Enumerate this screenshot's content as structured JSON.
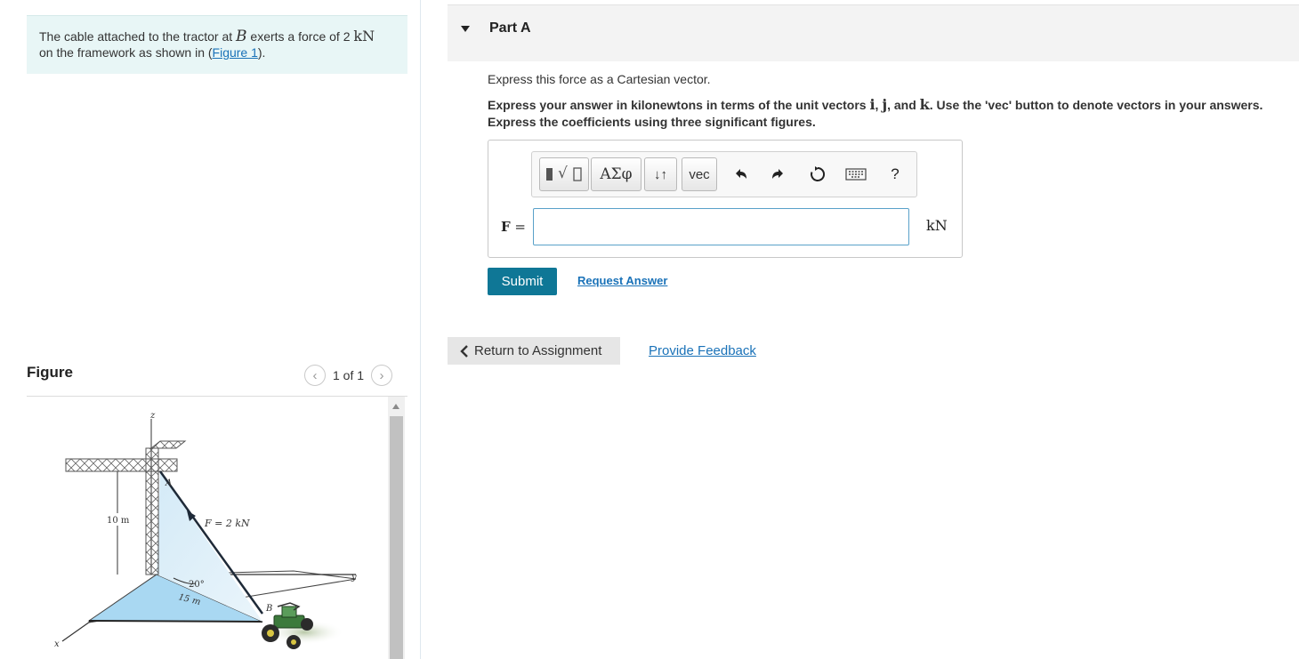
{
  "problem": {
    "text_before": "The cable attached to the tractor at ",
    "point_b": "B",
    "text_middle": " exerts a force of 2 ",
    "unit_kn": "kN",
    "text_line2": " on the framework as shown in (",
    "figure_link": "Figure 1",
    "text_end": ")."
  },
  "figure_panel": {
    "label": "Figure",
    "pager_text": "1 of 1",
    "diagram_labels": {
      "z": "z",
      "a": "A",
      "height": "10 m",
      "force": "F = 2 kN",
      "y": "y",
      "angle": "20°",
      "distance": "15 m",
      "b": "B",
      "x": "x"
    }
  },
  "part": {
    "title": "Part A",
    "instruction": "Express this force as a Cartesian vector.",
    "detail_1": "Express your answer in kilonewtons in terms of the unit vectors ",
    "vec_i": "i",
    "sep_1": ", ",
    "vec_j": "j",
    "sep_2": ", and ",
    "vec_k": "k",
    "detail_2": ". Use the 'vec' button to denote vectors in your answers. Express the coefficients using three significant figures."
  },
  "toolbar": {
    "templates_label": "√",
    "greek_label": "ΑΣφ",
    "arrows_label": "↓↑",
    "vec_label": "vec",
    "help_label": "?"
  },
  "answer": {
    "var_label": "F",
    "equals": " =",
    "value": "",
    "unit": "kN"
  },
  "actions": {
    "submit": "Submit",
    "request": "Request Answer",
    "return": "Return to Assignment",
    "feedback": "Provide Feedback"
  },
  "colors": {
    "problem_bg": "#e8f6f6",
    "submit_bg": "#0f7796",
    "link": "#1a72b8",
    "input_border": "#59a1c9"
  }
}
